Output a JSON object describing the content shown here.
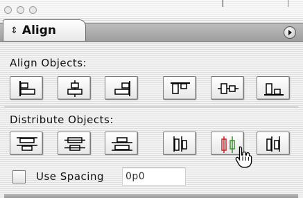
{
  "panel": {
    "tab_label": "Align",
    "tab_arrows": "⇕"
  },
  "align_section": {
    "label": "Align Objects:",
    "buttons": [
      {
        "name": "align-left-edges-button",
        "icon": "align-left-edges-icon"
      },
      {
        "name": "align-horizontal-centers-button",
        "icon": "align-horizontal-centers-icon"
      },
      {
        "name": "align-right-edges-button",
        "icon": "align-right-edges-icon"
      },
      {
        "name": "align-top-edges-button",
        "icon": "align-top-edges-icon"
      },
      {
        "name": "align-vertical-centers-button",
        "icon": "align-vertical-centers-icon"
      },
      {
        "name": "align-bottom-edges-button",
        "icon": "align-bottom-edges-icon"
      }
    ]
  },
  "distribute_section": {
    "label": "Distribute  Objects:",
    "buttons": [
      {
        "name": "distribute-top-edges-button",
        "icon": "distribute-top-edges-icon"
      },
      {
        "name": "distribute-vertical-centers-button",
        "icon": "distribute-vertical-centers-icon"
      },
      {
        "name": "distribute-bottom-edges-button",
        "icon": "distribute-bottom-edges-icon"
      },
      {
        "name": "distribute-left-edges-button",
        "icon": "distribute-left-edges-icon"
      },
      {
        "name": "distribute-horizontal-centers-button",
        "icon": "distribute-horizontal-centers-icon"
      },
      {
        "name": "distribute-right-edges-button",
        "icon": "distribute-right-edges-icon"
      }
    ]
  },
  "use_spacing": {
    "label": "Use Spacing",
    "checked": false,
    "value": "0p0"
  },
  "colors": {
    "accent_red": "#c8202a",
    "accent_green": "#3a8a2a"
  }
}
